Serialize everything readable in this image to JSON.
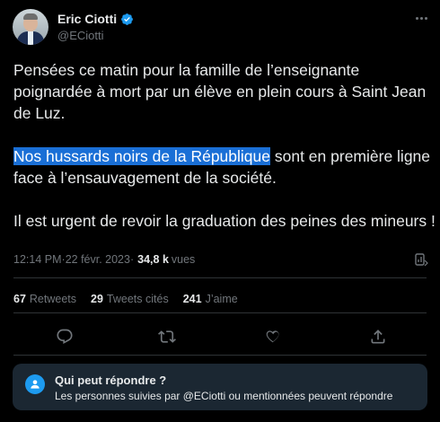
{
  "author": {
    "display_name": "Eric Ciotti",
    "handle": "@ECiotti",
    "verified": true
  },
  "tweet": {
    "text_p1": "Pensées ce matin pour la famille de l’enseignante poignardée à mort par un élève en plein cours à Saint Jean de Luz.",
    "text_p2_highlight": "Nos hussards noirs de la République",
    "text_p2_rest": " sont en première ligne face à l’ensauvagement de la société.",
    "text_p3": "Il est urgent de revoir la graduation des peines des mineurs !"
  },
  "meta": {
    "time": "12:14 PM",
    "separator": " · ",
    "date": "22 févr. 2023",
    "views_count": "34,8 k",
    "views_label": "vues"
  },
  "stats": {
    "retweets_count": "67",
    "retweets_label": "Retweets",
    "quotes_count": "29",
    "quotes_label": "Tweets cités",
    "likes_count": "241",
    "likes_label": "J’aime"
  },
  "actions": [
    "reply-icon",
    "retweet-icon",
    "like-icon",
    "share-icon"
  ],
  "reply_restriction": {
    "title": "Qui peut répondre ?",
    "description": "Les personnes suivies par @ECiotti ou mentionnées peuvent répondre"
  },
  "colors": {
    "background": "#000000",
    "text": "#e7e9ea",
    "muted": "#71767b",
    "accent": "#1d9bf0",
    "highlight": "#1a6fd6",
    "notice_bg": "#1b2732"
  }
}
